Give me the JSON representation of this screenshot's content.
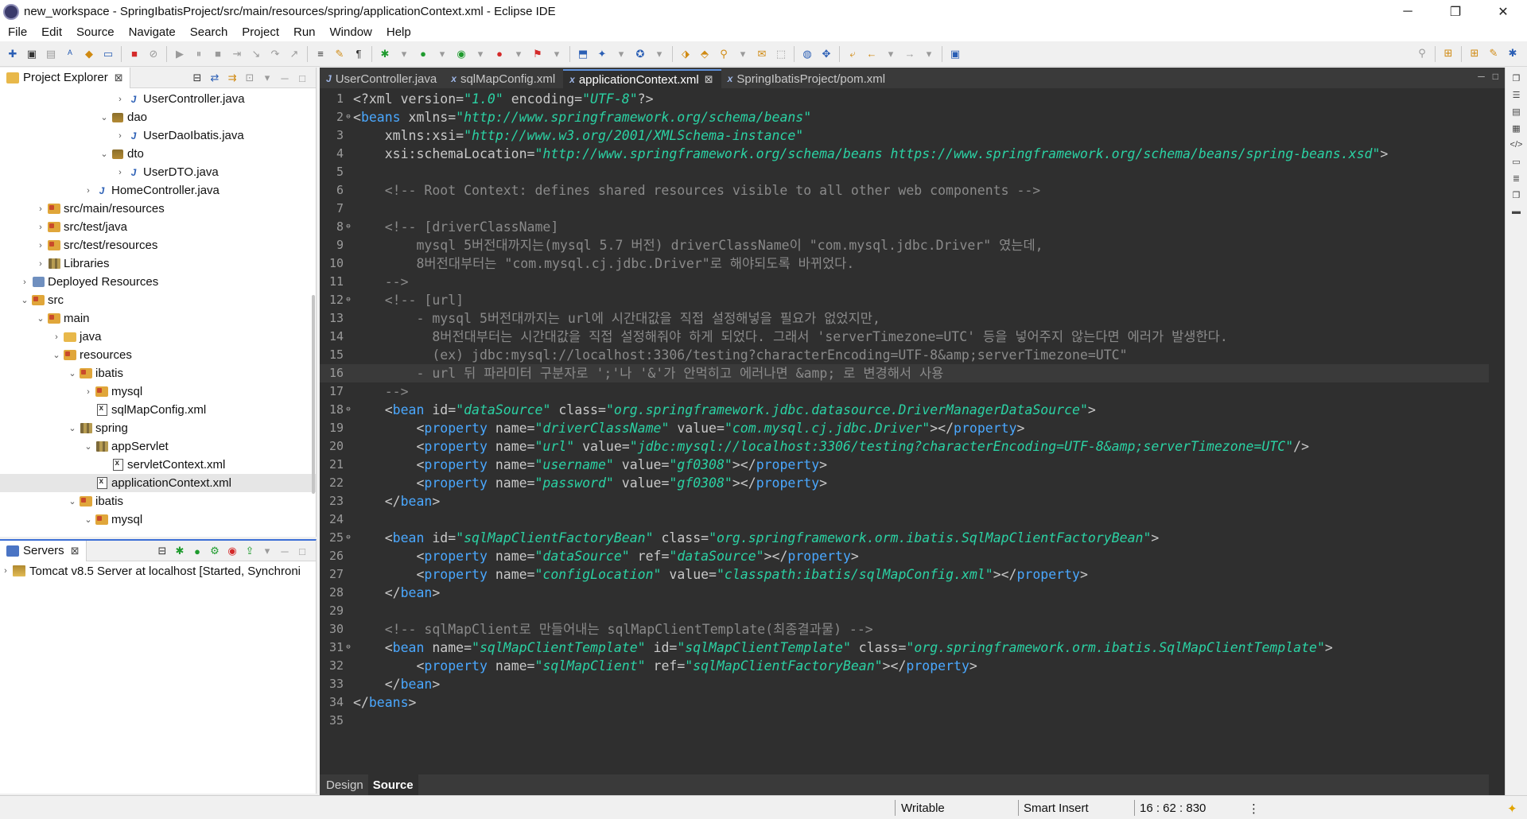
{
  "window": {
    "title": "new_workspace - SpringIbatisProject/src/main/resources/spring/applicationContext.xml - Eclipse IDE",
    "minimize": "─",
    "restore": "❐",
    "close": "✕"
  },
  "menu": [
    "File",
    "Edit",
    "Source",
    "Navigate",
    "Search",
    "Project",
    "Run",
    "Window",
    "Help"
  ],
  "explorer": {
    "tab_label": "Project Explorer",
    "items": [
      {
        "label": "UserController.java",
        "indent": 7,
        "arrow": "›",
        "icon": "java"
      },
      {
        "label": "dao",
        "indent": 6,
        "arrow": "⌄",
        "icon": "package"
      },
      {
        "label": "UserDaoIbatis.java",
        "indent": 7,
        "arrow": "›",
        "icon": "java"
      },
      {
        "label": "dto",
        "indent": 6,
        "arrow": "⌄",
        "icon": "package"
      },
      {
        "label": "UserDTO.java",
        "indent": 7,
        "arrow": "›",
        "icon": "java"
      },
      {
        "label": "HomeController.java",
        "indent": 5,
        "arrow": "›",
        "icon": "java"
      },
      {
        "label": "src/main/resources",
        "indent": 2,
        "arrow": "›",
        "icon": "srcfolder"
      },
      {
        "label": "src/test/java",
        "indent": 2,
        "arrow": "›",
        "icon": "srcfolder"
      },
      {
        "label": "src/test/resources",
        "indent": 2,
        "arrow": "›",
        "icon": "srcfolder"
      },
      {
        "label": "Libraries",
        "indent": 2,
        "arrow": "›",
        "icon": "library"
      },
      {
        "label": "Deployed Resources",
        "indent": 1,
        "arrow": "›",
        "icon": "deploy"
      },
      {
        "label": "src",
        "indent": 1,
        "arrow": "⌄",
        "icon": "srcfolder"
      },
      {
        "label": "main",
        "indent": 2,
        "arrow": "⌄",
        "icon": "srcfolder"
      },
      {
        "label": "java",
        "indent": 3,
        "arrow": "›",
        "icon": "folder"
      },
      {
        "label": "resources",
        "indent": 3,
        "arrow": "⌄",
        "icon": "srcfolder"
      },
      {
        "label": "ibatis",
        "indent": 4,
        "arrow": "⌄",
        "icon": "srcfolder"
      },
      {
        "label": "mysql",
        "indent": 5,
        "arrow": "›",
        "icon": "srcfolder"
      },
      {
        "label": "sqlMapConfig.xml",
        "indent": 5,
        "arrow": "",
        "icon": "xml"
      },
      {
        "label": "spring",
        "indent": 4,
        "arrow": "⌄",
        "icon": "library"
      },
      {
        "label": "appServlet",
        "indent": 5,
        "arrow": "⌄",
        "icon": "library"
      },
      {
        "label": "servletContext.xml",
        "indent": 6,
        "arrow": "",
        "icon": "xml"
      },
      {
        "label": "applicationContext.xml",
        "indent": 5,
        "arrow": "",
        "icon": "xml",
        "selected": true
      },
      {
        "label": "ibatis",
        "indent": 4,
        "arrow": "⌄",
        "icon": "srcfolder"
      },
      {
        "label": "mysql",
        "indent": 5,
        "arrow": "⌄",
        "icon": "srcfolder"
      }
    ]
  },
  "servers": {
    "tab_label": "Servers",
    "row": "Tomcat v8.5 Server at localhost  [Started, Synchroni"
  },
  "editor": {
    "tabs": [
      {
        "label": "UserController.java",
        "icon": "J",
        "active": false
      },
      {
        "label": "sqlMapConfig.xml",
        "icon": "x",
        "active": false
      },
      {
        "label": "applicationContext.xml",
        "icon": "x",
        "active": true
      },
      {
        "label": "SpringIbatisProject/pom.xml",
        "icon": "x",
        "active": false
      }
    ],
    "current_line": 16,
    "lines": [
      {
        "n": 1,
        "fold": "",
        "tokens": [
          [
            "b",
            "<?"
          ],
          [
            "p",
            "xml "
          ],
          [
            "a",
            "version="
          ],
          [
            "v",
            "\"1.0\""
          ],
          [
            "a",
            " encoding="
          ],
          [
            "v",
            "\"UTF-8\""
          ],
          [
            "b",
            "?>"
          ]
        ]
      },
      {
        "n": 2,
        "fold": "⊖",
        "tokens": [
          [
            "b",
            "<"
          ],
          [
            "t",
            "beans"
          ],
          [
            "a",
            " xmlns="
          ],
          [
            "v",
            "\"http://www.springframework.org/schema/beans\""
          ]
        ]
      },
      {
        "n": 3,
        "fold": "",
        "tokens": [
          [
            "a",
            "    xmlns:xsi="
          ],
          [
            "v",
            "\"http://www.w3.org/2001/XMLSchema-instance\""
          ]
        ]
      },
      {
        "n": 4,
        "fold": "",
        "tokens": [
          [
            "a",
            "    xsi:schemaLocation="
          ],
          [
            "v",
            "\"http://www.springframework.org/schema/beans https://www.springframework.org/schema/beans/spring-beans.xsd\""
          ],
          [
            "b",
            ">"
          ]
        ]
      },
      {
        "n": 5,
        "fold": "",
        "tokens": []
      },
      {
        "n": 6,
        "fold": "",
        "tokens": [
          [
            "c",
            "    <!-- Root Context: defines shared resources visible to all other web components -->"
          ]
        ]
      },
      {
        "n": 7,
        "fold": "",
        "tokens": []
      },
      {
        "n": 8,
        "fold": "⊖",
        "tokens": [
          [
            "c",
            "    <!-- [driverClassName]"
          ]
        ]
      },
      {
        "n": 9,
        "fold": "",
        "tokens": [
          [
            "c",
            "        mysql 5버전대까지는(mysql 5.7 버전) driverClassName이 \"com.mysql.jdbc.Driver\" 였는데,"
          ]
        ]
      },
      {
        "n": 10,
        "fold": "",
        "tokens": [
          [
            "c",
            "        8버전대부터는 \"com.mysql.cj.jdbc.Driver\"로 해야되도록 바뀌었다."
          ]
        ]
      },
      {
        "n": 11,
        "fold": "",
        "tokens": [
          [
            "c",
            "    -->"
          ]
        ]
      },
      {
        "n": 12,
        "fold": "⊖",
        "tokens": [
          [
            "c",
            "    <!-- [url]"
          ]
        ]
      },
      {
        "n": 13,
        "fold": "",
        "tokens": [
          [
            "c",
            "        - mysql 5버전대까지는 url에 시간대값을 직접 설정해넣을 필요가 없었지만,"
          ]
        ]
      },
      {
        "n": 14,
        "fold": "",
        "tokens": [
          [
            "c",
            "          8버전대부터는 시간대값을 직접 설정해줘야 하게 되었다. 그래서 'serverTimezone=UTC' 등을 넣어주지 않는다면 에러가 발생한다."
          ]
        ]
      },
      {
        "n": 15,
        "fold": "",
        "tokens": [
          [
            "c",
            "          (ex) jdbc:mysql://localhost:3306/testing?characterEncoding=UTF-8&amp;serverTimezone=UTC\""
          ]
        ]
      },
      {
        "n": 16,
        "fold": "",
        "tokens": [
          [
            "c",
            "        - url 뒤 파라미터 구분자로 ';'나 '&'가 안먹히고 에러나면 &amp; 로 변경해서 사용"
          ]
        ]
      },
      {
        "n": 17,
        "fold": "",
        "tokens": [
          [
            "c",
            "    -->"
          ]
        ]
      },
      {
        "n": 18,
        "fold": "⊖",
        "tokens": [
          [
            "b",
            "    <"
          ],
          [
            "t",
            "bean"
          ],
          [
            "a",
            " id="
          ],
          [
            "v",
            "\"dataSource\""
          ],
          [
            "a",
            " class="
          ],
          [
            "v",
            "\"org.springframework.jdbc.datasource.DriverManagerDataSource\""
          ],
          [
            "b",
            ">"
          ]
        ]
      },
      {
        "n": 19,
        "fold": "",
        "tokens": [
          [
            "b",
            "        <"
          ],
          [
            "t",
            "property"
          ],
          [
            "a",
            " name="
          ],
          [
            "v",
            "\"driverClassName\""
          ],
          [
            "a",
            " value="
          ],
          [
            "v",
            "\"com.mysql.cj.jdbc.Driver\""
          ],
          [
            "b",
            "></"
          ],
          [
            "t",
            "property"
          ],
          [
            "b",
            ">"
          ]
        ]
      },
      {
        "n": 20,
        "fold": "",
        "tokens": [
          [
            "b",
            "        <"
          ],
          [
            "t",
            "property"
          ],
          [
            "a",
            " name="
          ],
          [
            "v",
            "\"url\""
          ],
          [
            "a",
            " value="
          ],
          [
            "v",
            "\"jdbc:mysql://localhost:3306/testing?characterEncoding=UTF-8&amp;serverTimezone=UTC\""
          ],
          [
            "b",
            "/>"
          ]
        ]
      },
      {
        "n": 21,
        "fold": "",
        "tokens": [
          [
            "b",
            "        <"
          ],
          [
            "t",
            "property"
          ],
          [
            "a",
            " name="
          ],
          [
            "v",
            "\"username\""
          ],
          [
            "a",
            " value="
          ],
          [
            "v",
            "\"gf0308\""
          ],
          [
            "b",
            "></"
          ],
          [
            "t",
            "property"
          ],
          [
            "b",
            ">"
          ]
        ]
      },
      {
        "n": 22,
        "fold": "",
        "tokens": [
          [
            "b",
            "        <"
          ],
          [
            "t",
            "property"
          ],
          [
            "a",
            " name="
          ],
          [
            "v",
            "\"password\""
          ],
          [
            "a",
            " value="
          ],
          [
            "v",
            "\"gf0308\""
          ],
          [
            "b",
            "></"
          ],
          [
            "t",
            "property"
          ],
          [
            "b",
            ">"
          ]
        ]
      },
      {
        "n": 23,
        "fold": "",
        "tokens": [
          [
            "b",
            "    </"
          ],
          [
            "t",
            "bean"
          ],
          [
            "b",
            ">"
          ]
        ]
      },
      {
        "n": 24,
        "fold": "",
        "tokens": []
      },
      {
        "n": 25,
        "fold": "⊖",
        "tokens": [
          [
            "b",
            "    <"
          ],
          [
            "t",
            "bean"
          ],
          [
            "a",
            " id="
          ],
          [
            "v",
            "\"sqlMapClientFactoryBean\""
          ],
          [
            "a",
            " class="
          ],
          [
            "v",
            "\"org.springframework.orm.ibatis.SqlMapClientFactoryBean\""
          ],
          [
            "b",
            ">"
          ]
        ]
      },
      {
        "n": 26,
        "fold": "",
        "tokens": [
          [
            "b",
            "        <"
          ],
          [
            "t",
            "property"
          ],
          [
            "a",
            " name="
          ],
          [
            "v",
            "\"dataSource\""
          ],
          [
            "a",
            " ref="
          ],
          [
            "v",
            "\"dataSource\""
          ],
          [
            "b",
            "></"
          ],
          [
            "t",
            "property"
          ],
          [
            "b",
            ">"
          ]
        ]
      },
      {
        "n": 27,
        "fold": "",
        "tokens": [
          [
            "b",
            "        <"
          ],
          [
            "t",
            "property"
          ],
          [
            "a",
            " name="
          ],
          [
            "v",
            "\"configLocation\""
          ],
          [
            "a",
            " value="
          ],
          [
            "v",
            "\"classpath:ibatis/sqlMapConfig.xml\""
          ],
          [
            "b",
            "></"
          ],
          [
            "t",
            "property"
          ],
          [
            "b",
            ">"
          ]
        ]
      },
      {
        "n": 28,
        "fold": "",
        "tokens": [
          [
            "b",
            "    </"
          ],
          [
            "t",
            "bean"
          ],
          [
            "b",
            ">"
          ]
        ]
      },
      {
        "n": 29,
        "fold": "",
        "tokens": []
      },
      {
        "n": 30,
        "fold": "",
        "tokens": [
          [
            "c",
            "    <!-- sqlMapClient로 만들어내는 sqlMapClientTemplate(최종결과물) -->"
          ]
        ]
      },
      {
        "n": 31,
        "fold": "⊖",
        "tokens": [
          [
            "b",
            "    <"
          ],
          [
            "t",
            "bean"
          ],
          [
            "a",
            " name="
          ],
          [
            "v",
            "\"sqlMapClientTemplate\""
          ],
          [
            "a",
            " id="
          ],
          [
            "v",
            "\"sqlMapClientTemplate\""
          ],
          [
            "a",
            " class="
          ],
          [
            "v",
            "\"org.springframework.orm.ibatis.SqlMapClientTemplate\""
          ],
          [
            "b",
            ">"
          ]
        ]
      },
      {
        "n": 32,
        "fold": "",
        "tokens": [
          [
            "b",
            "        <"
          ],
          [
            "t",
            "property"
          ],
          [
            "a",
            " name="
          ],
          [
            "v",
            "\"sqlMapClient\""
          ],
          [
            "a",
            " ref="
          ],
          [
            "v",
            "\"sqlMapClientFactoryBean\""
          ],
          [
            "b",
            "></"
          ],
          [
            "t",
            "property"
          ],
          [
            "b",
            ">"
          ]
        ]
      },
      {
        "n": 33,
        "fold": "",
        "tokens": [
          [
            "b",
            "    </"
          ],
          [
            "t",
            "bean"
          ],
          [
            "b",
            ">"
          ]
        ]
      },
      {
        "n": 34,
        "fold": "",
        "tokens": [
          [
            "b",
            "</"
          ],
          [
            "t",
            "beans"
          ],
          [
            "b",
            ">"
          ]
        ]
      },
      {
        "n": 35,
        "fold": "",
        "tokens": []
      }
    ],
    "bottom_tabs": [
      {
        "label": "Design",
        "active": false
      },
      {
        "label": "Source",
        "active": true
      }
    ]
  },
  "statusbar": {
    "writable": "Writable",
    "insert_mode": "Smart Insert",
    "position": "16 : 62 : 830",
    "more": "⋮"
  },
  "colors": {
    "editor_bg": "#2f2f2f",
    "tag": "#4aa8ff",
    "attr_value": "#2bd2a4",
    "comment": "#8a8a8a"
  }
}
